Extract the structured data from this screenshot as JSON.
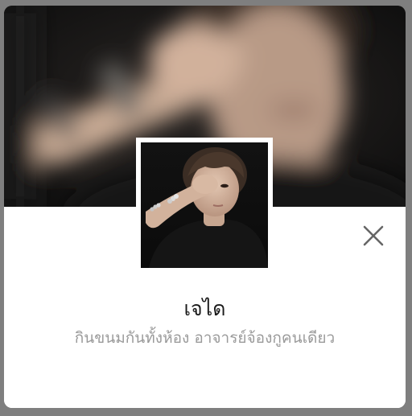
{
  "profile": {
    "display_name": "เจได",
    "status_message": "กินขนมกันทั้งห้อง อาจารย์จ้องกูคนเดียว"
  },
  "icons": {
    "close": "close-icon"
  },
  "colors": {
    "name_text": "#1b1b1b",
    "status_text": "#9a9a9a",
    "card_bg": "#ffffff",
    "cover_bg": "#141414",
    "close_icon": "#666666"
  }
}
